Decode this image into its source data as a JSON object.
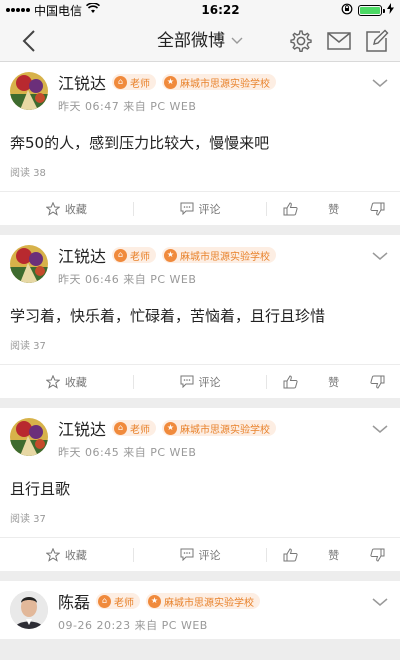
{
  "status": {
    "carrier": "中国电信",
    "time": "16:22",
    "battery_color": "#4cd964"
  },
  "nav": {
    "title": "全部微博",
    "icons": [
      "back-icon",
      "chevron-down-icon",
      "gear-icon",
      "mail-icon",
      "compose-icon"
    ]
  },
  "actions": {
    "favorite": "收藏",
    "comment": "评论",
    "like": "赞"
  },
  "posts": [
    {
      "name": "江锐达",
      "role": "老师",
      "school": "麻城市思源实验学校",
      "meta": "昨天 06:47 来自 PC WEB",
      "content": "奔50的人，感到压力比较大，慢慢来吧",
      "reads": "阅读 38"
    },
    {
      "name": "江锐达",
      "role": "老师",
      "school": "麻城市思源实验学校",
      "meta": "昨天 06:46 来自 PC WEB",
      "content": "学习着，快乐着，忙碌着，苦恼着，且行且珍惜",
      "reads": "阅读 37"
    },
    {
      "name": "江锐达",
      "role": "老师",
      "school": "麻城市思源实验学校",
      "meta": "昨天 06:45 来自 PC WEB",
      "content": "且行且歌",
      "reads": "阅读 37"
    },
    {
      "name": "陈磊",
      "role": "老师",
      "school": "麻城市思源实验学校",
      "meta": "09-26 20:23 来自 PC WEB"
    }
  ],
  "colors": {
    "accent_orange": "#f08a3c",
    "badge_bg": "#fdeee3"
  }
}
